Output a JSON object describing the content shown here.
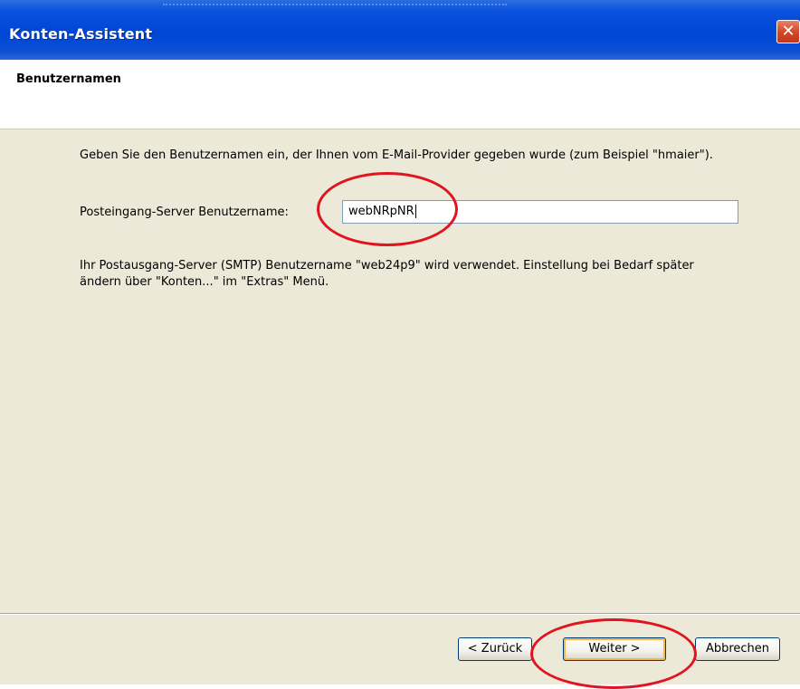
{
  "window": {
    "title": "Konten-Assistent",
    "close_glyph": "✕"
  },
  "header": {
    "heading": "Benutzernamen"
  },
  "body": {
    "instruction": "Geben Sie den Benutzernamen ein, der Ihnen vom E-Mail-Provider gegeben wurde (zum Beispiel \"hmaier\").",
    "incoming_label": "Posteingang-Server Benutzername:",
    "incoming_value": "webNRpNR",
    "smtp_note": "Ihr Postausgang-Server (SMTP) Benutzername \"web24p9\" wird verwendet. Einstellung bei Bedarf später ändern über \"Konten...\" im \"Extras\" Menü."
  },
  "buttons": {
    "back": "< Zurück",
    "next": "Weiter >",
    "cancel": "Abbrechen"
  },
  "colors": {
    "titlebar": "#0046d6",
    "dialog_bg": "#ece9d8",
    "annotation": "#e0141e"
  },
  "icons": {
    "close": "close-icon"
  }
}
